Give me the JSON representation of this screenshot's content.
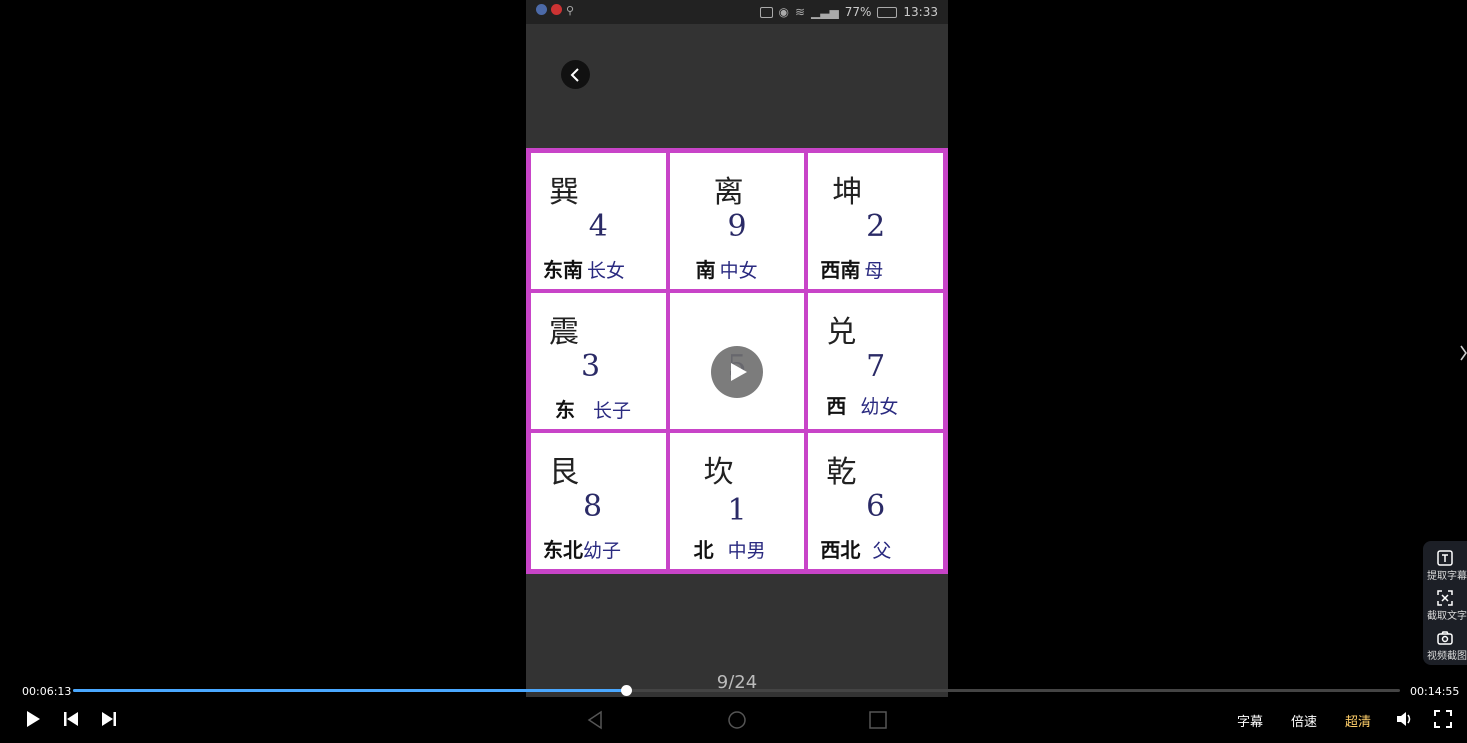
{
  "statusbar": {
    "battery": "77%",
    "time": "13:33"
  },
  "grid": [
    {
      "trigram": "巽",
      "number": "4",
      "direction": "东南",
      "family": "长女"
    },
    {
      "trigram": "离",
      "number": "9",
      "direction": "南",
      "family": "中女"
    },
    {
      "trigram": "坤",
      "number": "2",
      "direction": "西南",
      "family": "母"
    },
    {
      "trigram": "震",
      "number": "3",
      "direction": "东",
      "family": "长子"
    },
    {
      "trigram": "",
      "number": "5",
      "direction": "",
      "family": ""
    },
    {
      "trigram": "兑",
      "number": "7",
      "direction": "西",
      "family": "幼女"
    },
    {
      "trigram": "艮",
      "number": "8",
      "direction": "东北",
      "family": "幼子"
    },
    {
      "trigram": "坎",
      "number": "1",
      "direction": "北",
      "family": "中男"
    },
    {
      "trigram": "乾",
      "number": "6",
      "direction": "西北",
      "family": "父"
    }
  ],
  "page_indicator": "9/24",
  "player": {
    "current_time": "00:06:13",
    "total_time": "00:14:55",
    "progress_fraction": 0.417,
    "subtitle_label": "字幕",
    "speed_label": "倍速",
    "quality_label": "超清"
  },
  "side_tools": [
    {
      "label": "提取字幕"
    },
    {
      "label": "截取文字"
    },
    {
      "label": "视频截图"
    }
  ],
  "colors": {
    "grid_border": "#c844c8",
    "progress": "#4aa8ff",
    "quality": "#ffcf6a"
  }
}
